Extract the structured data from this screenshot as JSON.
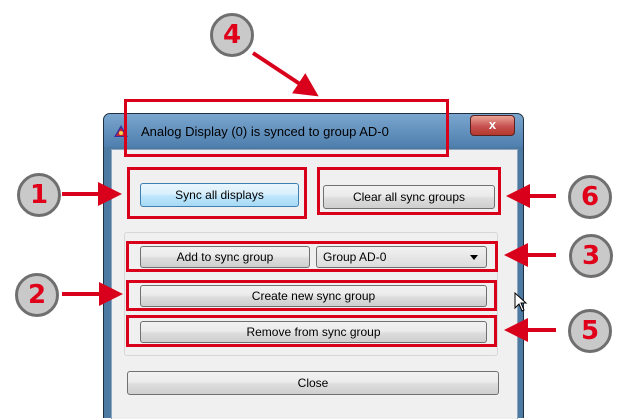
{
  "window": {
    "title": "Analog Display (0) is synced to group AD-0",
    "close_glyph": "x",
    "app_icon": "satellite-icon"
  },
  "buttons": {
    "sync_all": "Sync all displays",
    "clear_all": "Clear all sync groups",
    "add_to_group": "Add to sync group",
    "create_new": "Create new sync group",
    "remove_from": "Remove from sync group",
    "close": "Close"
  },
  "group_select": {
    "value": "Group AD-0"
  },
  "callouts": [
    "1",
    "2",
    "3",
    "4",
    "5",
    "6"
  ],
  "colors": {
    "highlight": "#d9001b",
    "callout_fill": "#c9c9c9",
    "callout_text": "#e0001a"
  }
}
